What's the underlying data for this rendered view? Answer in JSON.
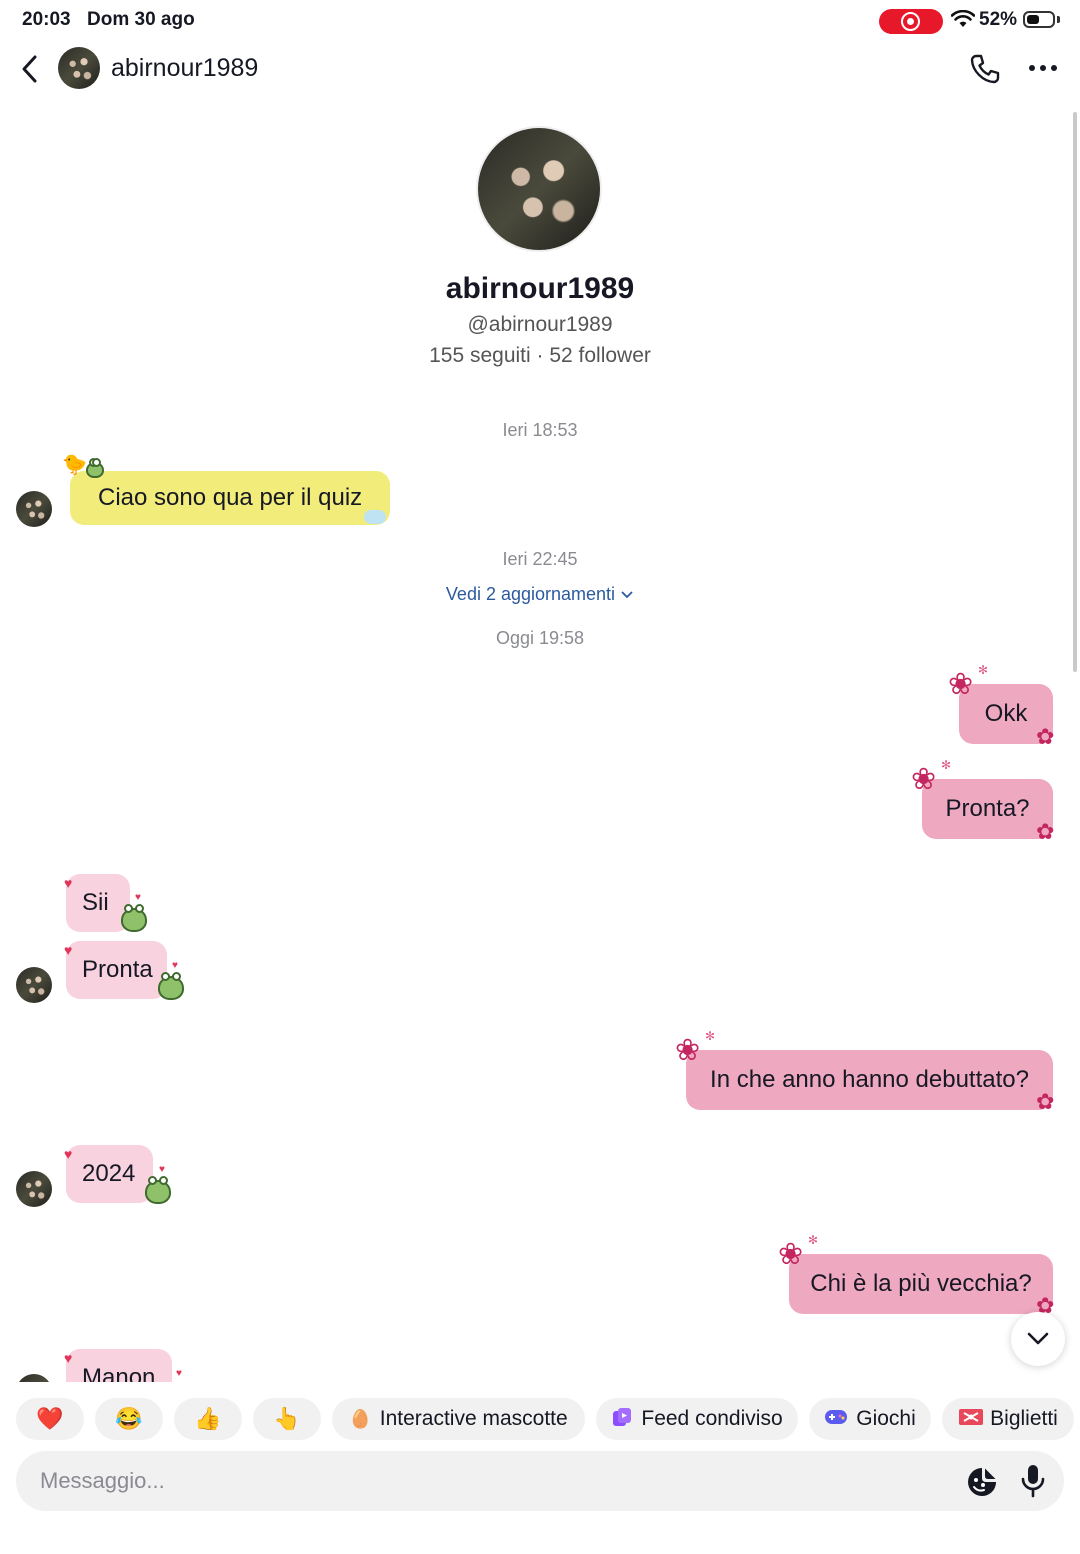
{
  "status_bar": {
    "time": "20:03",
    "date": "Dom 30 ago",
    "battery_percent": "52%",
    "battery_level": 0.52
  },
  "header": {
    "username": "abirnour1989",
    "back_icon": "chevron-left-icon",
    "call_icon": "phone-icon",
    "more_icon": "ellipsis-icon"
  },
  "profile": {
    "name": "abirnour1989",
    "handle": "@abirnour1989",
    "stats": "155 seguiti · 52 follower"
  },
  "conversation": {
    "timestamp_1": "Ieri 18:53",
    "timestamp_2": "Ieri 22:45",
    "updates_link": "Vedi 2 aggiornamenti",
    "timestamp_3": "Oggi 19:58",
    "messages": [
      {
        "from": "them",
        "text": "Ciao sono qua per il quiz"
      },
      {
        "from": "me",
        "text": "Okk"
      },
      {
        "from": "me",
        "text": "Pronta?"
      },
      {
        "from": "them",
        "text": "Sii"
      },
      {
        "from": "them",
        "text": "Pronta"
      },
      {
        "from": "me",
        "text": "In che anno hanno debuttato?"
      },
      {
        "from": "them",
        "text": "2024"
      },
      {
        "from": "me",
        "text": "Chi è la più vecchia?"
      },
      {
        "from": "them",
        "text": "Manon"
      }
    ]
  },
  "quick_bar": {
    "emoji_1": "❤️",
    "emoji_2": "😂",
    "emoji_3": "👍",
    "emoji_4": "👆",
    "chips": [
      "Interactive mascotte",
      "Feed condiviso",
      "Giochi",
      "Biglietti"
    ]
  },
  "composer": {
    "placeholder": "Messaggio...",
    "sticker_icon": "sticker-icon",
    "mic_icon": "microphone-icon"
  },
  "colors": {
    "accent_pink": "#eea9c1",
    "incoming_pink": "#f8d2de",
    "yellow_bubble": "#f2ec7a",
    "link_blue": "#2c5aa0",
    "record_red": "#e8182b"
  }
}
